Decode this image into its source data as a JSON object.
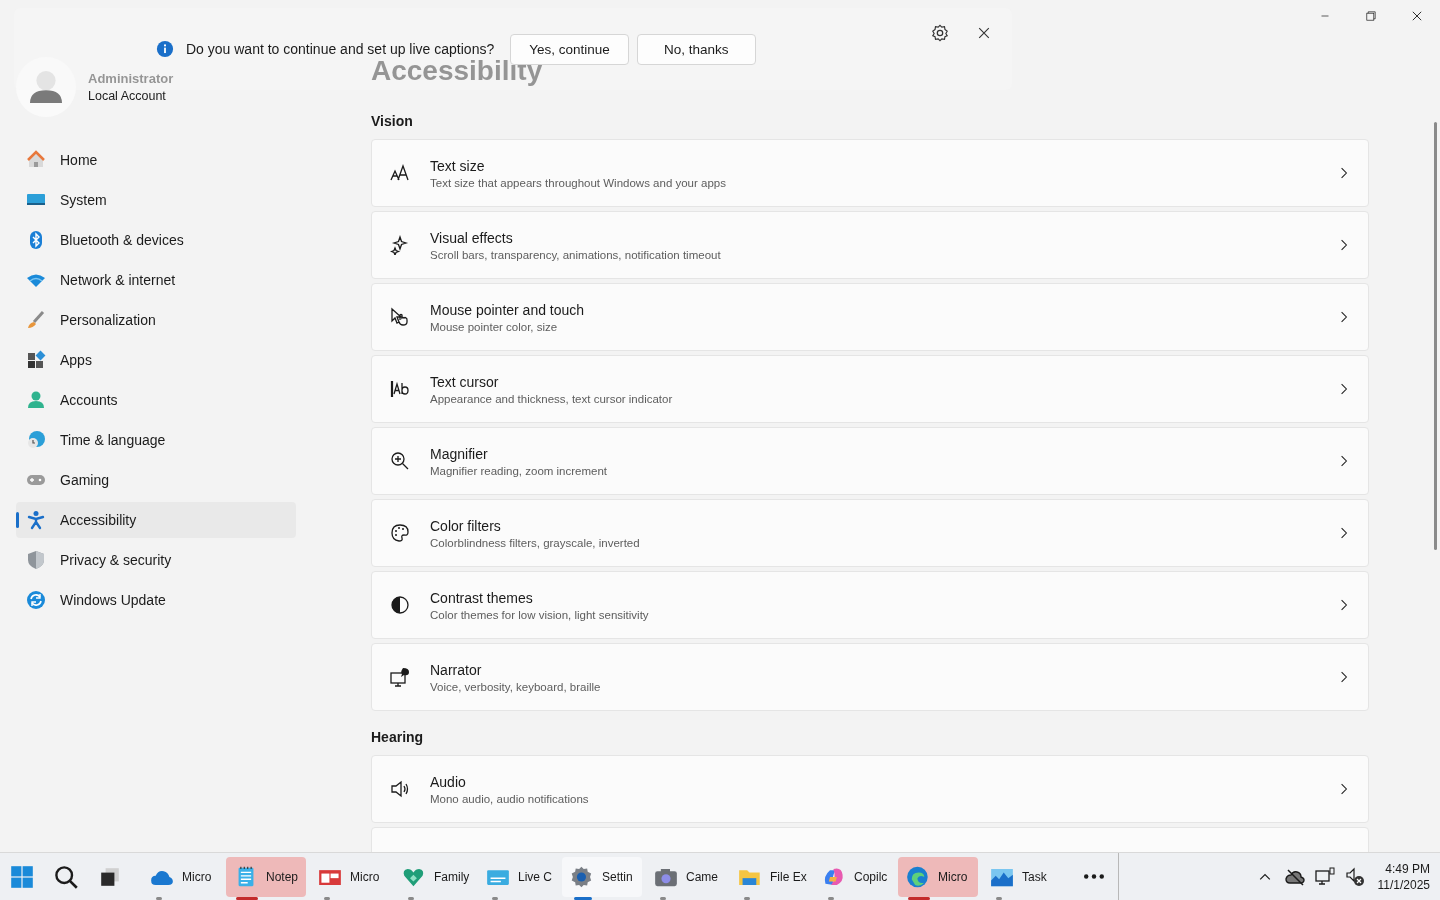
{
  "caption_prompt": {
    "message": "Do you want to continue and set up live captions?",
    "buttons": [
      "Yes, continue",
      "No, thanks"
    ]
  },
  "account": {
    "name": "Administrator",
    "type": "Local Account"
  },
  "nav": [
    {
      "label": "Home",
      "selected": false
    },
    {
      "label": "System",
      "selected": false
    },
    {
      "label": "Bluetooth & devices",
      "selected": false
    },
    {
      "label": "Network & internet",
      "selected": false
    },
    {
      "label": "Personalization",
      "selected": false
    },
    {
      "label": "Apps",
      "selected": false
    },
    {
      "label": "Accounts",
      "selected": false
    },
    {
      "label": "Time & language",
      "selected": false
    },
    {
      "label": "Gaming",
      "selected": false
    },
    {
      "label": "Accessibility",
      "selected": true
    },
    {
      "label": "Privacy & security",
      "selected": false
    },
    {
      "label": "Windows Update",
      "selected": false
    }
  ],
  "page_title": "Accessibility",
  "sections": [
    {
      "heading": "Vision",
      "items": [
        {
          "title": "Text size",
          "description": "Text size that appears throughout Windows and your apps"
        },
        {
          "title": "Visual effects",
          "description": "Scroll bars, transparency, animations, notification timeout"
        },
        {
          "title": "Mouse pointer and touch",
          "description": "Mouse pointer color, size"
        },
        {
          "title": "Text cursor",
          "description": "Appearance and thickness, text cursor indicator"
        },
        {
          "title": "Magnifier",
          "description": "Magnifier reading, zoom increment"
        },
        {
          "title": "Color filters",
          "description": "Colorblindness filters, grayscale, inverted"
        },
        {
          "title": "Contrast themes",
          "description": "Color themes for low vision, light sensitivity"
        },
        {
          "title": "Narrator",
          "description": "Voice, verbosity, keyboard, braille"
        }
      ]
    },
    {
      "heading": "Hearing",
      "items": [
        {
          "title": "Audio",
          "description": "Mono audio, audio notifications"
        }
      ]
    }
  ],
  "taskbar": {
    "apps": [
      {
        "label": "Micro",
        "selected": false,
        "attention": false
      },
      {
        "label": "Notep",
        "selected": false,
        "attention": true
      },
      {
        "label": "Micro",
        "selected": false,
        "attention": false
      },
      {
        "label": "Family",
        "selected": false,
        "attention": false
      },
      {
        "label": "Live C",
        "selected": false,
        "attention": false
      },
      {
        "label": "Settin",
        "selected": true,
        "attention": false
      },
      {
        "label": "Came",
        "selected": false,
        "attention": false
      },
      {
        "label": "File Ex",
        "selected": false,
        "attention": false
      },
      {
        "label": "Copilc",
        "selected": false,
        "attention": false
      },
      {
        "label": "Micro",
        "selected": false,
        "attention": true
      },
      {
        "label": "Task",
        "selected": false,
        "attention": false
      }
    ],
    "time": "4:49 PM",
    "date": "11/1/2025"
  }
}
